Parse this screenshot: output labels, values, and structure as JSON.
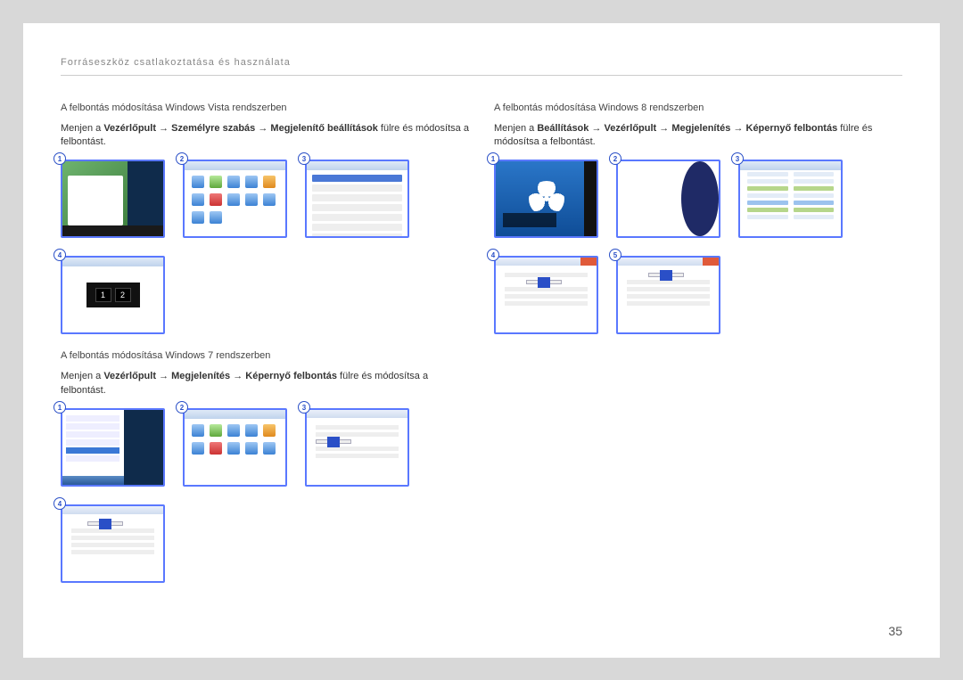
{
  "header": "Forráseszköz csatlakoztatása és használata",
  "page_number": "35",
  "vista": {
    "title": "A felbontás módosítása Windows Vista rendszerben",
    "instr_prefix": "Menjen a ",
    "path": [
      "Vezérlőpult",
      "Személyre szabás",
      "Megjelenítő beállítások"
    ],
    "instr_suffix": " fülre és módosítsa a felbontást.",
    "steps": [
      "1",
      "2",
      "3",
      "4"
    ]
  },
  "win7": {
    "title": "A felbontás módosítása Windows 7 rendszerben",
    "instr_prefix": "Menjen a ",
    "path": [
      "Vezérlőpult",
      "Megjelenítés",
      "Képernyő felbontás"
    ],
    "instr_suffix": " fülre és módosítsa a felbontást.",
    "steps": [
      "1",
      "2",
      "3",
      "4"
    ]
  },
  "win8": {
    "title": "A felbontás módosítása Windows 8 rendszerben",
    "instr_prefix": "Menjen a ",
    "path": [
      "Beállítások",
      "Vezérlőpult",
      "Megjelenítés",
      "Képernyő felbontás"
    ],
    "instr_suffix": " fülre és módosítsa a felbontást.",
    "steps": [
      "1",
      "2",
      "3",
      "4",
      "5"
    ]
  }
}
